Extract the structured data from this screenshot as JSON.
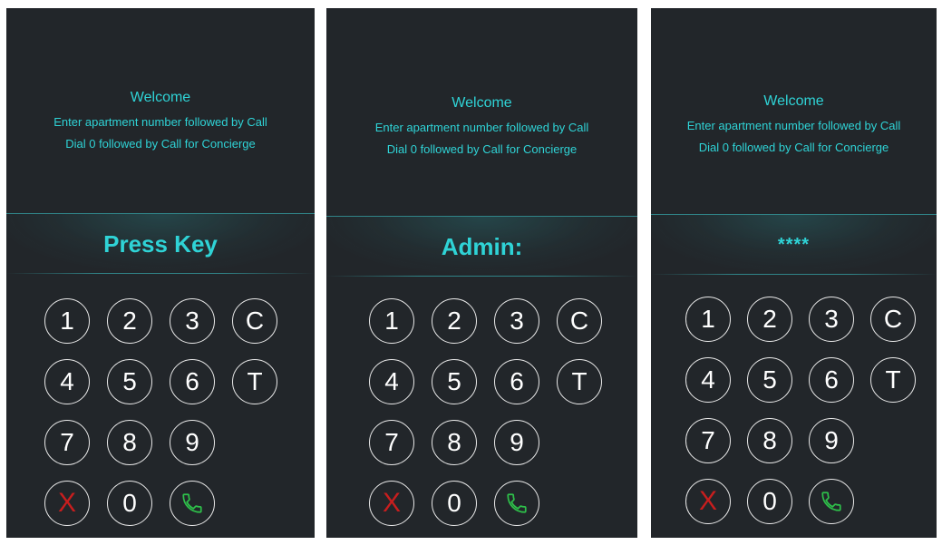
{
  "panels": [
    {
      "welcome": "Welcome",
      "instructions": [
        "Enter apartment number followed by Call",
        "Dial 0 followed by Call for Concierge"
      ],
      "display": "Press Key"
    },
    {
      "welcome": "Welcome",
      "instructions": [
        "Enter apartment number followed by Call",
        "Dial 0 followed by Call for Concierge"
      ],
      "display": "Admin:"
    },
    {
      "welcome": "Welcome",
      "instructions": [
        "Enter apartment number followed by Call",
        "Dial 0 followed by Call for Concierge"
      ],
      "display": "****"
    }
  ],
  "keypad": {
    "rows": [
      [
        "1",
        "2",
        "3",
        "C"
      ],
      [
        "4",
        "5",
        "6",
        "T"
      ],
      [
        "7",
        "8",
        "9"
      ],
      [
        "X",
        "0",
        "call-icon"
      ]
    ]
  },
  "colors": {
    "background": "#22262a",
    "accent": "#2fd3d6",
    "key_border": "#e9e9e9",
    "cancel": "#c81e1e",
    "call": "#2ec04a"
  }
}
